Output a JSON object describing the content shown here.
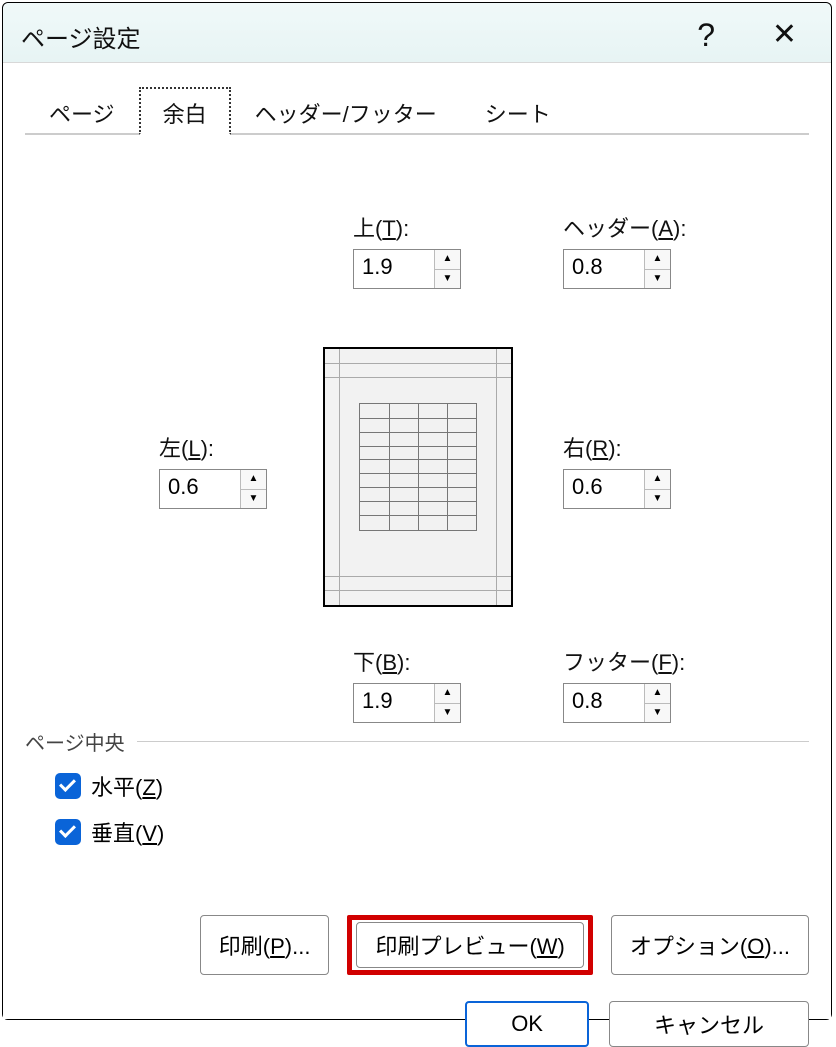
{
  "dialog": {
    "title": "ページ設定"
  },
  "tabs": {
    "page": "ページ",
    "margins": "余白",
    "hf": "ヘッダー/フッター",
    "sheet": "シート"
  },
  "margins": {
    "top": {
      "label_pre": "上(",
      "key": "T",
      "label_post": "):",
      "value": "1.9"
    },
    "header": {
      "label_pre": "ヘッダー(",
      "key": "A",
      "label_post": "):",
      "value": "0.8"
    },
    "left": {
      "label_pre": "左(",
      "key": "L",
      "label_post": "):",
      "value": "0.6"
    },
    "right": {
      "label_pre": "右(",
      "key": "R",
      "label_post": "):",
      "value": "0.6"
    },
    "bottom": {
      "label_pre": "下(",
      "key": "B",
      "label_post": "):",
      "value": "1.9"
    },
    "footer": {
      "label_pre": "フッター(",
      "key": "F",
      "label_post": "):",
      "value": "0.8"
    }
  },
  "center": {
    "group": "ページ中央",
    "horizontal": {
      "pre": "水平(",
      "key": "Z",
      "post": ")",
      "checked": true
    },
    "vertical": {
      "pre": "垂直(",
      "key": "V",
      "post": ")",
      "checked": true
    }
  },
  "buttons": {
    "print": {
      "pre": "印刷(",
      "key": "P",
      "post": ")..."
    },
    "preview": {
      "pre": "印刷プレビュー(",
      "key": "W",
      "post": ")"
    },
    "options": {
      "pre": "オプション(",
      "key": "O",
      "post": ")..."
    },
    "ok": "OK",
    "cancel": "キャンセル"
  }
}
